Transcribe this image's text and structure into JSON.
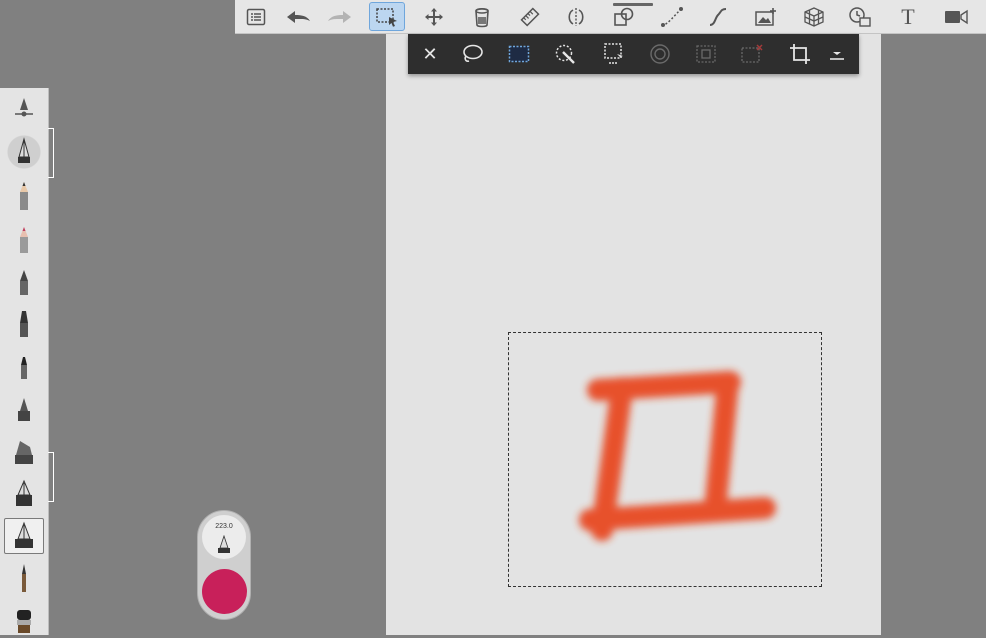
{
  "app": {
    "top_toolbar": {
      "tools": [
        {
          "name": "menu-icon"
        },
        {
          "name": "undo-icon"
        },
        {
          "name": "redo-icon"
        },
        {
          "name": "selection-tool-icon"
        },
        {
          "name": "transform-icon"
        },
        {
          "name": "fill-icon"
        },
        {
          "name": "ruler-icon"
        },
        {
          "name": "symmetry-icon"
        },
        {
          "name": "shape-icon"
        },
        {
          "name": "stroke-icon"
        },
        {
          "name": "curve-icon"
        },
        {
          "name": "add-image-icon"
        },
        {
          "name": "perspective-icon"
        },
        {
          "name": "timelapse-icon"
        },
        {
          "name": "text-icon"
        },
        {
          "name": "video-icon"
        }
      ],
      "text_tool_label": "T"
    },
    "selection_toolbar": {
      "close_label": "✕"
    },
    "brush_puck": {
      "size_value": "223.0",
      "color": "#c8205a"
    },
    "stroke_color": "#e8441e",
    "accent": "#6fa6dc"
  }
}
